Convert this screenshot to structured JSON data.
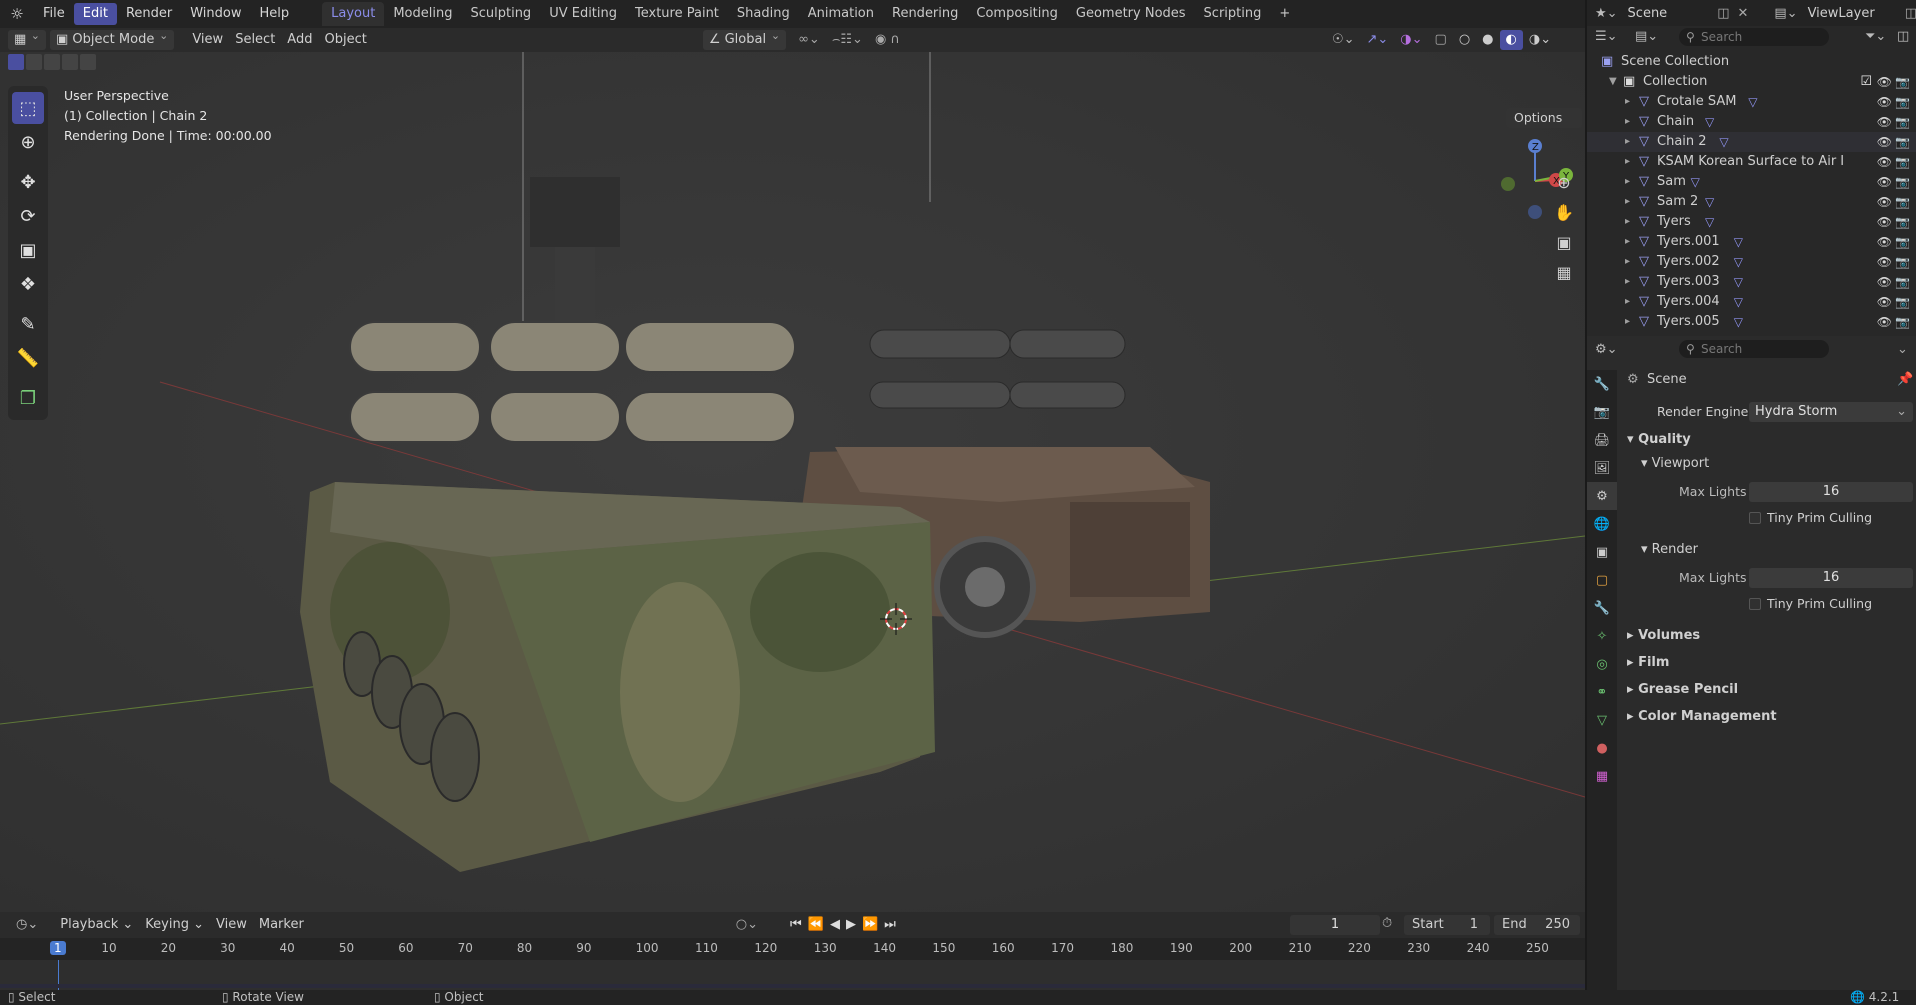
{
  "app": {
    "menu": [
      "File",
      "Edit",
      "Render",
      "Window",
      "Help"
    ],
    "active_menu": "Edit"
  },
  "workspaces": [
    "Layout",
    "Modeling",
    "Sculpting",
    "UV Editing",
    "Texture Paint",
    "Shading",
    "Animation",
    "Rendering",
    "Compositing",
    "Geometry Nodes",
    "Scripting"
  ],
  "active_workspace": "Layout",
  "scene": {
    "name": "Scene",
    "view_layer": "ViewLayer"
  },
  "header3d": {
    "mode": "Object Mode",
    "menus": [
      "View",
      "Select",
      "Add",
      "Object"
    ],
    "transform_orientation": "Global",
    "options_label": "Options"
  },
  "viewport": {
    "line1": "User Perspective",
    "line2": "(1) Collection | Chain 2",
    "line3": "Rendering Done | Time: 00:00.00"
  },
  "gizmo": {
    "x": "X",
    "y": "Y",
    "z": "Z"
  },
  "outliner": {
    "search_placeholder": "Search",
    "root": "Scene Collection",
    "collection": "Collection",
    "items": [
      "Crotale SAM",
      "Chain",
      "Chain 2",
      "KSAM Korean Surface to Air I",
      "Sam",
      "Sam 2",
      "Tyers",
      "Tyers.001",
      "Tyers.002",
      "Tyers.003",
      "Tyers.004",
      "Tyers.005"
    ]
  },
  "properties": {
    "search_placeholder": "Search",
    "context": "Scene",
    "render_engine_label": "Render Engine",
    "render_engine": "Hydra Storm",
    "quality": "Quality",
    "viewport": "Viewport",
    "max_lights_label": "Max Lights",
    "viewport_max_lights": "16",
    "tiny_prim": "Tiny Prim Culling",
    "render": "Render",
    "render_max_lights": "16",
    "sections": [
      "Volumes",
      "Film",
      "Grease Pencil",
      "Color Management"
    ]
  },
  "timeline": {
    "menus": [
      "Playback",
      "Keying",
      "View",
      "Marker"
    ],
    "current_frame": "1",
    "start_label": "Start",
    "start": "1",
    "end_label": "End",
    "end": "250",
    "ruler": [
      "1",
      "10",
      "20",
      "30",
      "40",
      "50",
      "60",
      "70",
      "80",
      "90",
      "100",
      "110",
      "120",
      "130",
      "140",
      "150",
      "160",
      "170",
      "180",
      "190",
      "200",
      "210",
      "220",
      "230",
      "240",
      "250"
    ]
  },
  "status": {
    "select": "Select",
    "rotate": "Rotate View",
    "object": "Object",
    "version": "4.2.1"
  },
  "colors": {
    "accent": "#4a4fa0",
    "x_axis": "#d04848",
    "y_axis": "#7ab53c",
    "z_axis": "#5a7fd0"
  }
}
